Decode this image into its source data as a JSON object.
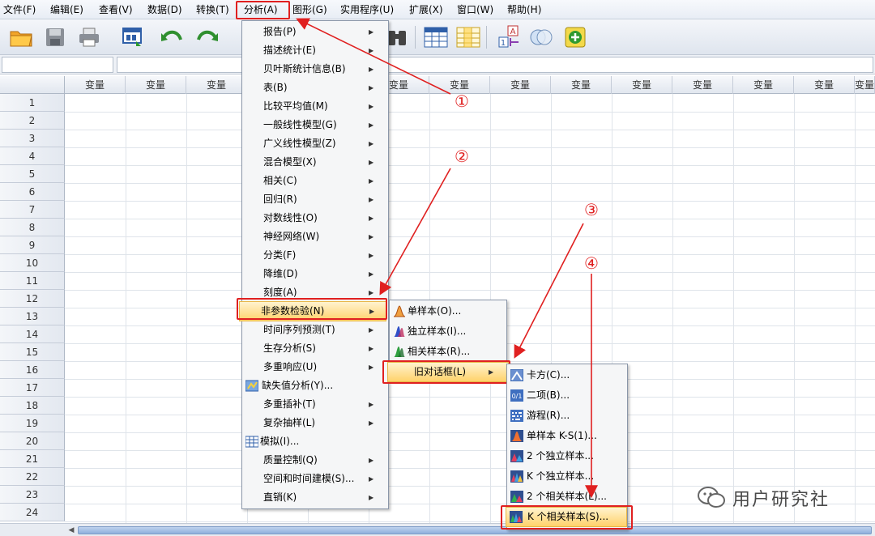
{
  "menubar": {
    "items": [
      "文件(F)",
      "编辑(E)",
      "查看(V)",
      "数据(D)",
      "转换(T)",
      "分析(A)",
      "图形(G)",
      "实用程序(U)",
      "扩展(X)",
      "窗口(W)",
      "帮助(H)"
    ]
  },
  "grid": {
    "column_header": "变量",
    "rows": [
      "1",
      "2",
      "3",
      "4",
      "5",
      "6",
      "7",
      "8",
      "9",
      "10",
      "11",
      "12",
      "13",
      "14",
      "15",
      "16",
      "17",
      "18",
      "19",
      "20",
      "21",
      "22",
      "23",
      "24"
    ]
  },
  "analyze_menu": {
    "items": [
      {
        "label": "报告(P)"
      },
      {
        "label": "描述统计(E)"
      },
      {
        "label": "贝叶斯统计信息(B)"
      },
      {
        "label": "表(B)"
      },
      {
        "label": "比较平均值(M)"
      },
      {
        "label": "一般线性模型(G)"
      },
      {
        "label": "广义线性模型(Z)"
      },
      {
        "label": "混合模型(X)"
      },
      {
        "label": "相关(C)"
      },
      {
        "label": "回归(R)"
      },
      {
        "label": "对数线性(O)"
      },
      {
        "label": "神经网络(W)"
      },
      {
        "label": "分类(F)"
      },
      {
        "label": "降维(D)"
      },
      {
        "label": "刻度(A)"
      },
      {
        "label": "非参数检验(N)"
      },
      {
        "label": "时间序列预测(T)"
      },
      {
        "label": "生存分析(S)"
      },
      {
        "label": "多重响应(U)"
      },
      {
        "label": "缺失值分析(Y)..."
      },
      {
        "label": "多重插补(T)"
      },
      {
        "label": "复杂抽样(L)"
      },
      {
        "label": "模拟(I)..."
      },
      {
        "label": "质量控制(Q)"
      },
      {
        "label": "空间和时间建模(S)..."
      },
      {
        "label": "直销(K)"
      }
    ]
  },
  "nonparam_menu": {
    "items": [
      {
        "label": "单样本(O)..."
      },
      {
        "label": "独立样本(I)..."
      },
      {
        "label": "相关样本(R)..."
      },
      {
        "label": "旧对话框(L)"
      }
    ]
  },
  "legacy_menu": {
    "items": [
      {
        "label": "卡方(C)..."
      },
      {
        "label": "二项(B)..."
      },
      {
        "label": "游程(R)..."
      },
      {
        "label": "单样本 K-S(1)..."
      },
      {
        "label": "2 个独立样本..."
      },
      {
        "label": "K 个独立样本..."
      },
      {
        "label": "2 个相关样本(L)..."
      },
      {
        "label": "K 个相关样本(S)..."
      }
    ]
  },
  "annotations": {
    "step1": "①",
    "step2": "②",
    "step3": "③",
    "step4": "④",
    "color": "#e02020"
  },
  "watermark": {
    "text": "用户研究社"
  },
  "colors": {
    "highlight_top": "#fff3cf",
    "highlight_bottom": "#ffd26b",
    "menu_bg": "#f5f6f7",
    "annotation_red": "#e02020"
  }
}
